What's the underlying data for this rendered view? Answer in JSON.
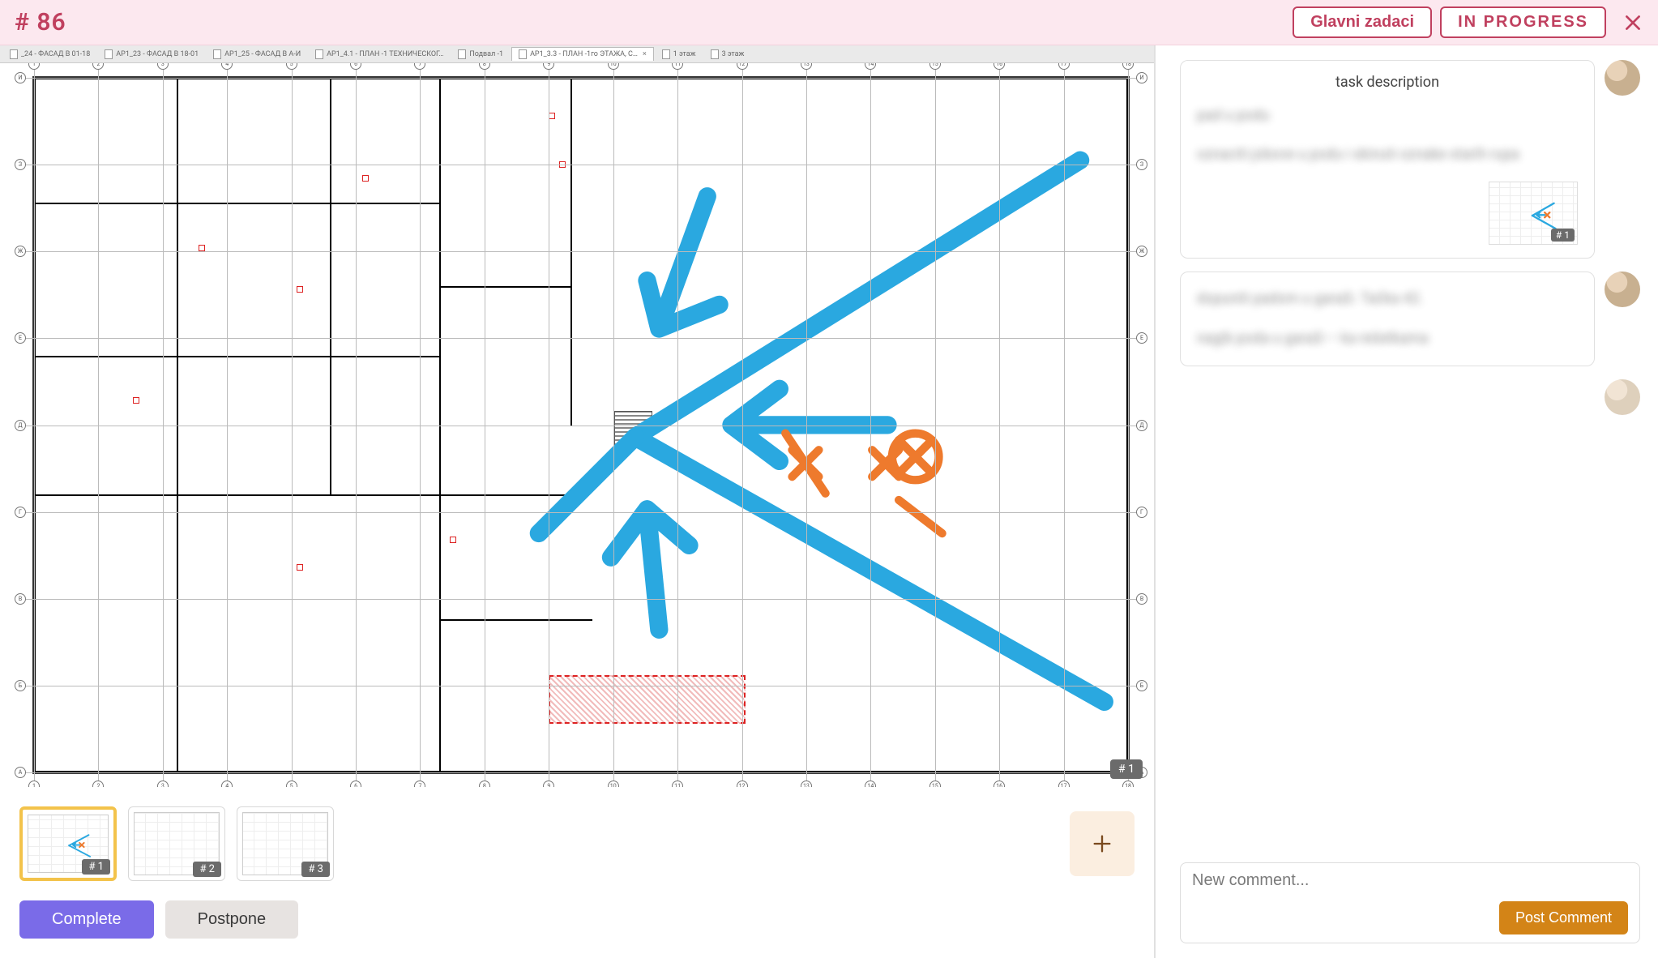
{
  "header": {
    "id_label": "# 86",
    "main_tasks_label": "Glavni zadaci",
    "status_label": "IN PROGRESS"
  },
  "viewer": {
    "tabs": [
      {
        "label": "_24 - ФАСАД В 01-18",
        "active": false
      },
      {
        "label": "АР1_23 - ФАСАД В 18-01",
        "active": false
      },
      {
        "label": "АР1_25 - ФАСАД В А-И",
        "active": false
      },
      {
        "label": "АР1_4.1 - ПЛАН -1 ТЕХНИЧЕСКОГ…",
        "active": false
      },
      {
        "label": "Подвал -1",
        "active": false
      },
      {
        "label": "АР1_3.3 - ПЛАН -1го ЭТАЖА, С…",
        "active": true
      },
      {
        "label": "1 этаж",
        "active": false
      },
      {
        "label": "3 этаж",
        "active": false
      }
    ],
    "grid_axes_top": [
      "1",
      "2",
      "3",
      "4",
      "5",
      "6",
      "7",
      "8",
      "9",
      "10",
      "11",
      "12",
      "13",
      "14",
      "15",
      "16",
      "17",
      "18"
    ],
    "grid_axes_left": [
      "И",
      "З",
      "Ж",
      "Е",
      "Д",
      "Г",
      "В",
      "Б",
      "А"
    ],
    "viewer_badge": "# 1"
  },
  "thumbnails": [
    {
      "badge": "# 1",
      "active": true,
      "has_scribble": true
    },
    {
      "badge": "# 2",
      "active": false,
      "has_scribble": false
    },
    {
      "badge": "# 3",
      "active": false,
      "has_scribble": false
    }
  ],
  "actions": {
    "complete_label": "Complete",
    "postpone_label": "Postpone"
  },
  "comments": {
    "task_description_title": "task description",
    "task_description_body_1": "pad u podu",
    "task_description_body_2": "oznaciti jobove u podu i skinuti oznake starih rupa",
    "task_attachment_badge": "# 1",
    "comment_2_line_1": "dopuniti padom u garaži. Tačka 42.",
    "comment_2_line_2": "nagib poda u garaži – ka rešetkama"
  },
  "composer": {
    "placeholder": "New comment...",
    "post_label": "Post Comment"
  },
  "colors": {
    "accent_pink": "#c0405f",
    "annot_blue": "#2aa8e0",
    "annot_orange": "#ee7a2d",
    "primary_purple": "#7a6be8",
    "post_orange": "#d38417"
  }
}
